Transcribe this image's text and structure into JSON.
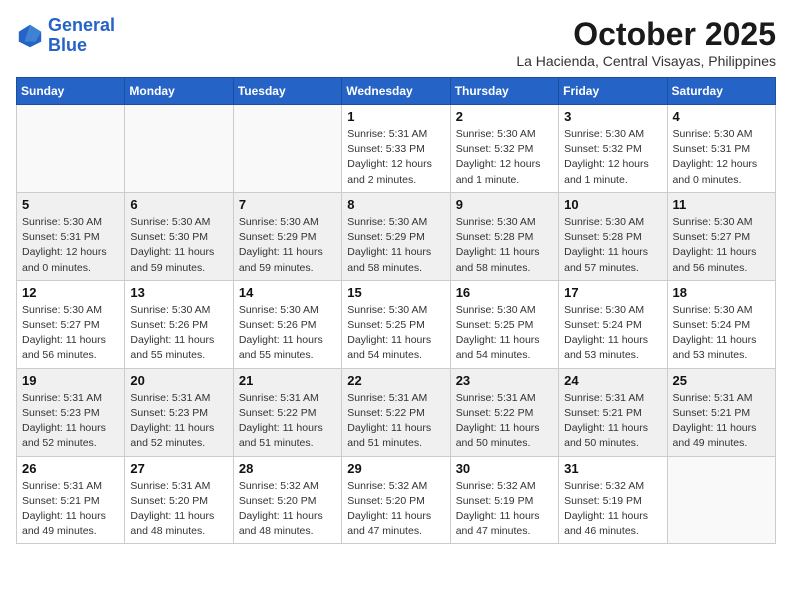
{
  "header": {
    "logo_line1": "General",
    "logo_line2": "Blue",
    "month": "October 2025",
    "location": "La Hacienda, Central Visayas, Philippines"
  },
  "weekdays": [
    "Sunday",
    "Monday",
    "Tuesday",
    "Wednesday",
    "Thursday",
    "Friday",
    "Saturday"
  ],
  "weeks": [
    [
      {
        "day": "",
        "info": ""
      },
      {
        "day": "",
        "info": ""
      },
      {
        "day": "",
        "info": ""
      },
      {
        "day": "1",
        "info": "Sunrise: 5:31 AM\nSunset: 5:33 PM\nDaylight: 12 hours\nand 2 minutes."
      },
      {
        "day": "2",
        "info": "Sunrise: 5:30 AM\nSunset: 5:32 PM\nDaylight: 12 hours\nand 1 minute."
      },
      {
        "day": "3",
        "info": "Sunrise: 5:30 AM\nSunset: 5:32 PM\nDaylight: 12 hours\nand 1 minute."
      },
      {
        "day": "4",
        "info": "Sunrise: 5:30 AM\nSunset: 5:31 PM\nDaylight: 12 hours\nand 0 minutes."
      }
    ],
    [
      {
        "day": "5",
        "info": "Sunrise: 5:30 AM\nSunset: 5:31 PM\nDaylight: 12 hours\nand 0 minutes."
      },
      {
        "day": "6",
        "info": "Sunrise: 5:30 AM\nSunset: 5:30 PM\nDaylight: 11 hours\nand 59 minutes."
      },
      {
        "day": "7",
        "info": "Sunrise: 5:30 AM\nSunset: 5:29 PM\nDaylight: 11 hours\nand 59 minutes."
      },
      {
        "day": "8",
        "info": "Sunrise: 5:30 AM\nSunset: 5:29 PM\nDaylight: 11 hours\nand 58 minutes."
      },
      {
        "day": "9",
        "info": "Sunrise: 5:30 AM\nSunset: 5:28 PM\nDaylight: 11 hours\nand 58 minutes."
      },
      {
        "day": "10",
        "info": "Sunrise: 5:30 AM\nSunset: 5:28 PM\nDaylight: 11 hours\nand 57 minutes."
      },
      {
        "day": "11",
        "info": "Sunrise: 5:30 AM\nSunset: 5:27 PM\nDaylight: 11 hours\nand 56 minutes."
      }
    ],
    [
      {
        "day": "12",
        "info": "Sunrise: 5:30 AM\nSunset: 5:27 PM\nDaylight: 11 hours\nand 56 minutes."
      },
      {
        "day": "13",
        "info": "Sunrise: 5:30 AM\nSunset: 5:26 PM\nDaylight: 11 hours\nand 55 minutes."
      },
      {
        "day": "14",
        "info": "Sunrise: 5:30 AM\nSunset: 5:26 PM\nDaylight: 11 hours\nand 55 minutes."
      },
      {
        "day": "15",
        "info": "Sunrise: 5:30 AM\nSunset: 5:25 PM\nDaylight: 11 hours\nand 54 minutes."
      },
      {
        "day": "16",
        "info": "Sunrise: 5:30 AM\nSunset: 5:25 PM\nDaylight: 11 hours\nand 54 minutes."
      },
      {
        "day": "17",
        "info": "Sunrise: 5:30 AM\nSunset: 5:24 PM\nDaylight: 11 hours\nand 53 minutes."
      },
      {
        "day": "18",
        "info": "Sunrise: 5:30 AM\nSunset: 5:24 PM\nDaylight: 11 hours\nand 53 minutes."
      }
    ],
    [
      {
        "day": "19",
        "info": "Sunrise: 5:31 AM\nSunset: 5:23 PM\nDaylight: 11 hours\nand 52 minutes."
      },
      {
        "day": "20",
        "info": "Sunrise: 5:31 AM\nSunset: 5:23 PM\nDaylight: 11 hours\nand 52 minutes."
      },
      {
        "day": "21",
        "info": "Sunrise: 5:31 AM\nSunset: 5:22 PM\nDaylight: 11 hours\nand 51 minutes."
      },
      {
        "day": "22",
        "info": "Sunrise: 5:31 AM\nSunset: 5:22 PM\nDaylight: 11 hours\nand 51 minutes."
      },
      {
        "day": "23",
        "info": "Sunrise: 5:31 AM\nSunset: 5:22 PM\nDaylight: 11 hours\nand 50 minutes."
      },
      {
        "day": "24",
        "info": "Sunrise: 5:31 AM\nSunset: 5:21 PM\nDaylight: 11 hours\nand 50 minutes."
      },
      {
        "day": "25",
        "info": "Sunrise: 5:31 AM\nSunset: 5:21 PM\nDaylight: 11 hours\nand 49 minutes."
      }
    ],
    [
      {
        "day": "26",
        "info": "Sunrise: 5:31 AM\nSunset: 5:21 PM\nDaylight: 11 hours\nand 49 minutes."
      },
      {
        "day": "27",
        "info": "Sunrise: 5:31 AM\nSunset: 5:20 PM\nDaylight: 11 hours\nand 48 minutes."
      },
      {
        "day": "28",
        "info": "Sunrise: 5:32 AM\nSunset: 5:20 PM\nDaylight: 11 hours\nand 48 minutes."
      },
      {
        "day": "29",
        "info": "Sunrise: 5:32 AM\nSunset: 5:20 PM\nDaylight: 11 hours\nand 47 minutes."
      },
      {
        "day": "30",
        "info": "Sunrise: 5:32 AM\nSunset: 5:19 PM\nDaylight: 11 hours\nand 47 minutes."
      },
      {
        "day": "31",
        "info": "Sunrise: 5:32 AM\nSunset: 5:19 PM\nDaylight: 11 hours\nand 46 minutes."
      },
      {
        "day": "",
        "info": ""
      }
    ]
  ]
}
